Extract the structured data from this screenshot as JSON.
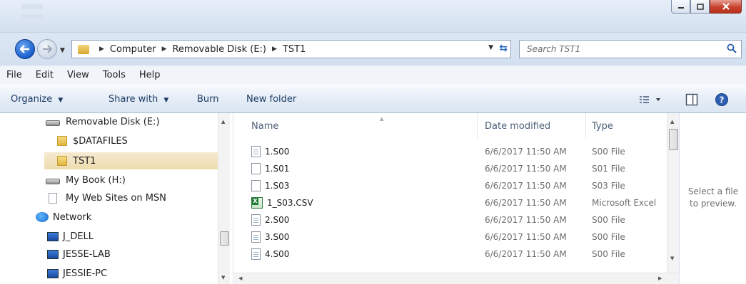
{
  "window": {
    "controls": {
      "minimize_icon": "minimize-icon",
      "maximize_icon": "maximize-icon",
      "close_icon": "close-icon"
    }
  },
  "address_bar": {
    "breadcrumbs": [
      "Computer",
      "Removable Disk (E:)",
      "TST1"
    ]
  },
  "search": {
    "placeholder": "Search TST1"
  },
  "menu": [
    "File",
    "Edit",
    "View",
    "Tools",
    "Help"
  ],
  "toolbar": {
    "organize": "Organize",
    "share_with": "Share with",
    "burn": "Burn",
    "new_folder": "New folder"
  },
  "nav_pane": {
    "items": [
      {
        "label": "Removable Disk (E:)",
        "icon": "drive-icon"
      },
      {
        "label": "$DATAFILES",
        "icon": "folder-icon"
      },
      {
        "label": "TST1",
        "icon": "folder-icon",
        "selected": true
      },
      {
        "label": "My Book (H:)",
        "icon": "drive-icon"
      },
      {
        "label": "My Web Sites on MSN",
        "icon": "page-icon"
      },
      {
        "label": "Network",
        "icon": "network-icon"
      },
      {
        "label": "J_DELL",
        "icon": "computer-icon"
      },
      {
        "label": "JESSE-LAB",
        "icon": "computer-icon"
      },
      {
        "label": "JESSIE-PC",
        "icon": "computer-icon"
      }
    ]
  },
  "file_list": {
    "columns": {
      "name": "Name",
      "date": "Date modified",
      "type": "Type"
    },
    "rows": [
      {
        "name": "1.S00",
        "date": "6/6/2017 11:50 AM",
        "type": "S00 File",
        "icon": "text-file-icon"
      },
      {
        "name": "1.S01",
        "date": "6/6/2017 11:50 AM",
        "type": "S01 File",
        "icon": "blank-file-icon"
      },
      {
        "name": "1.S03",
        "date": "6/6/2017 11:50 AM",
        "type": "S03 File",
        "icon": "blank-file-icon"
      },
      {
        "name": "1_S03.CSV",
        "date": "6/6/2017 11:50 AM",
        "type": "Microsoft Excel",
        "icon": "excel-file-icon"
      },
      {
        "name": "2.S00",
        "date": "6/6/2017 11:50 AM",
        "type": "S00 File",
        "icon": "text-file-icon"
      },
      {
        "name": "3.S00",
        "date": "6/6/2017 11:50 AM",
        "type": "S00 File",
        "icon": "text-file-icon"
      },
      {
        "name": "4.S00",
        "date": "6/6/2017 11:50 AM",
        "type": "S00 File",
        "icon": "text-file-icon"
      }
    ]
  },
  "preview": {
    "text": "Select a file to preview."
  },
  "colors": {
    "titlebar": "#dbe6f3",
    "selection": "#f0deb0",
    "toolbar_text": "#1e3c64",
    "link": "#2a6bbf"
  }
}
